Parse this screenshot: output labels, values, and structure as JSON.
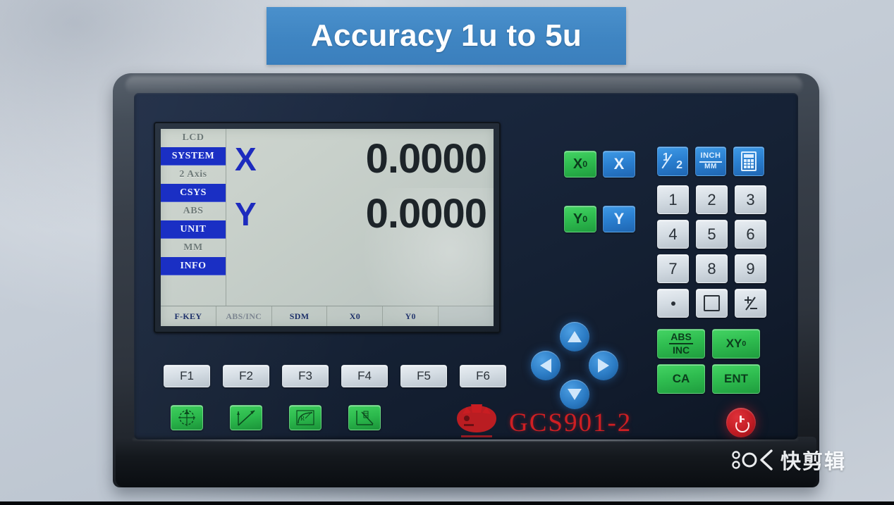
{
  "banner": {
    "text": "Accuracy 1u to 5u",
    "bg_color": "#3f85c2",
    "text_color": "#ffffff"
  },
  "device": {
    "model": "GCS901-2",
    "brand_logo": "bull-head-logo",
    "faceplate_color": "#152134",
    "shell_color": "#2e343d"
  },
  "lcd": {
    "background_color": "#c9d1cb",
    "highlight_color": "#1a2fc4",
    "sidebar": [
      {
        "label": "LCD",
        "highlighted": false
      },
      {
        "label": "SYSTEM",
        "highlighted": true
      },
      {
        "label": "2 Axis",
        "highlighted": false
      },
      {
        "label": "CSYS",
        "highlighted": true
      },
      {
        "label": "ABS",
        "highlighted": false
      },
      {
        "label": "UNIT",
        "highlighted": true
      },
      {
        "label": "MM",
        "highlighted": false
      },
      {
        "label": "INFO",
        "highlighted": true
      }
    ],
    "axes": [
      {
        "label": "X",
        "value": "0.0000"
      },
      {
        "label": "Y",
        "value": "0.0000"
      }
    ],
    "soft_keys": [
      {
        "label": "F-KEY",
        "state": "normal"
      },
      {
        "label": "ABS/INC",
        "state": "dim"
      },
      {
        "label": "SDM",
        "state": "normal"
      },
      {
        "label": "X0",
        "state": "normal"
      },
      {
        "label": "Y0",
        "state": "normal"
      },
      {
        "label": "",
        "state": "empty"
      }
    ]
  },
  "keypad": {
    "axis_keys": [
      {
        "name": "x-zero",
        "label": "X",
        "sub": "0",
        "color": "green"
      },
      {
        "name": "x-axis",
        "label": "X",
        "sub": "",
        "color": "blue"
      },
      {
        "name": "y-zero",
        "label": "Y",
        "sub": "0",
        "color": "green"
      },
      {
        "name": "y-axis",
        "label": "Y",
        "sub": "",
        "color": "blue"
      }
    ],
    "util_keys": [
      {
        "name": "half",
        "icon": "one-half-icon",
        "label_top": "1",
        "label_bottom": "2"
      },
      {
        "name": "inch-mm",
        "icon": "inch-mm-icon",
        "label_top": "INCH",
        "label_bottom": "MM"
      },
      {
        "name": "calc",
        "icon": "calculator-icon",
        "label_top": "",
        "label_bottom": ""
      }
    ],
    "numbers": [
      "1",
      "2",
      "3",
      "4",
      "5",
      "6",
      "7",
      "8",
      "9"
    ],
    "bottom_row": [
      {
        "name": "decimal-point",
        "label": ".",
        "glyph": "dot"
      },
      {
        "name": "zero",
        "label": "0",
        "glyph": "square"
      },
      {
        "name": "plus-minus",
        "label": "+/-",
        "glyph": "plusminus"
      }
    ],
    "mode_keys": [
      {
        "name": "abs-inc",
        "label_top": "ABS",
        "label_bottom": "INC"
      },
      {
        "name": "xy-zero",
        "label": "XY",
        "sub": "0"
      },
      {
        "name": "clear-all",
        "label": "CA"
      },
      {
        "name": "enter",
        "label": "ENT"
      }
    ],
    "arrows": [
      {
        "name": "arrow-up",
        "direction": "up"
      },
      {
        "name": "arrow-left",
        "direction": "left"
      },
      {
        "name": "arrow-right",
        "direction": "right"
      },
      {
        "name": "arrow-down",
        "direction": "down"
      }
    ],
    "function_keys": [
      "F1",
      "F2",
      "F3",
      "F4",
      "F5",
      "F6"
    ],
    "app_keys": [
      {
        "name": "bolt-hole-circle",
        "icon": "bolt-hole-circle-icon"
      },
      {
        "name": "linear-hole",
        "icon": "linear-hole-icon"
      },
      {
        "name": "arc-radius",
        "icon": "arc-radius-icon"
      },
      {
        "name": "taper-slope",
        "icon": "taper-slope-icon"
      }
    ],
    "power": {
      "name": "power",
      "icon": "power-icon",
      "color": "#c21c24"
    }
  },
  "watermark": {
    "text": "快剪辑",
    "mark": "kuaijianji-logo"
  }
}
